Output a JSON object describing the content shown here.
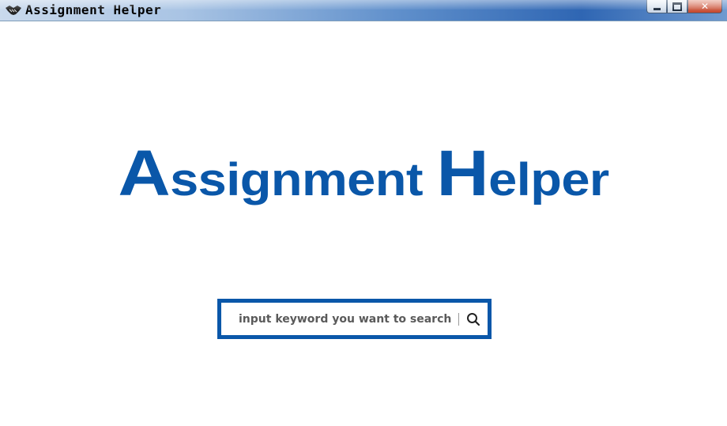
{
  "window": {
    "title": "Assignment Helper",
    "icon": "handshake-icon",
    "controls": [
      "minimize-icon",
      "maximize-icon",
      "close-icon"
    ]
  },
  "logo": {
    "first_initial": "A",
    "first_rest": "ssignment",
    "second_initial": "H",
    "second_rest": "elper",
    "color": "#0a57a9"
  },
  "search": {
    "placeholder": "input keyword you want to search",
    "value": "",
    "button_icon": "search-icon",
    "border_color": "#0a57a9"
  }
}
